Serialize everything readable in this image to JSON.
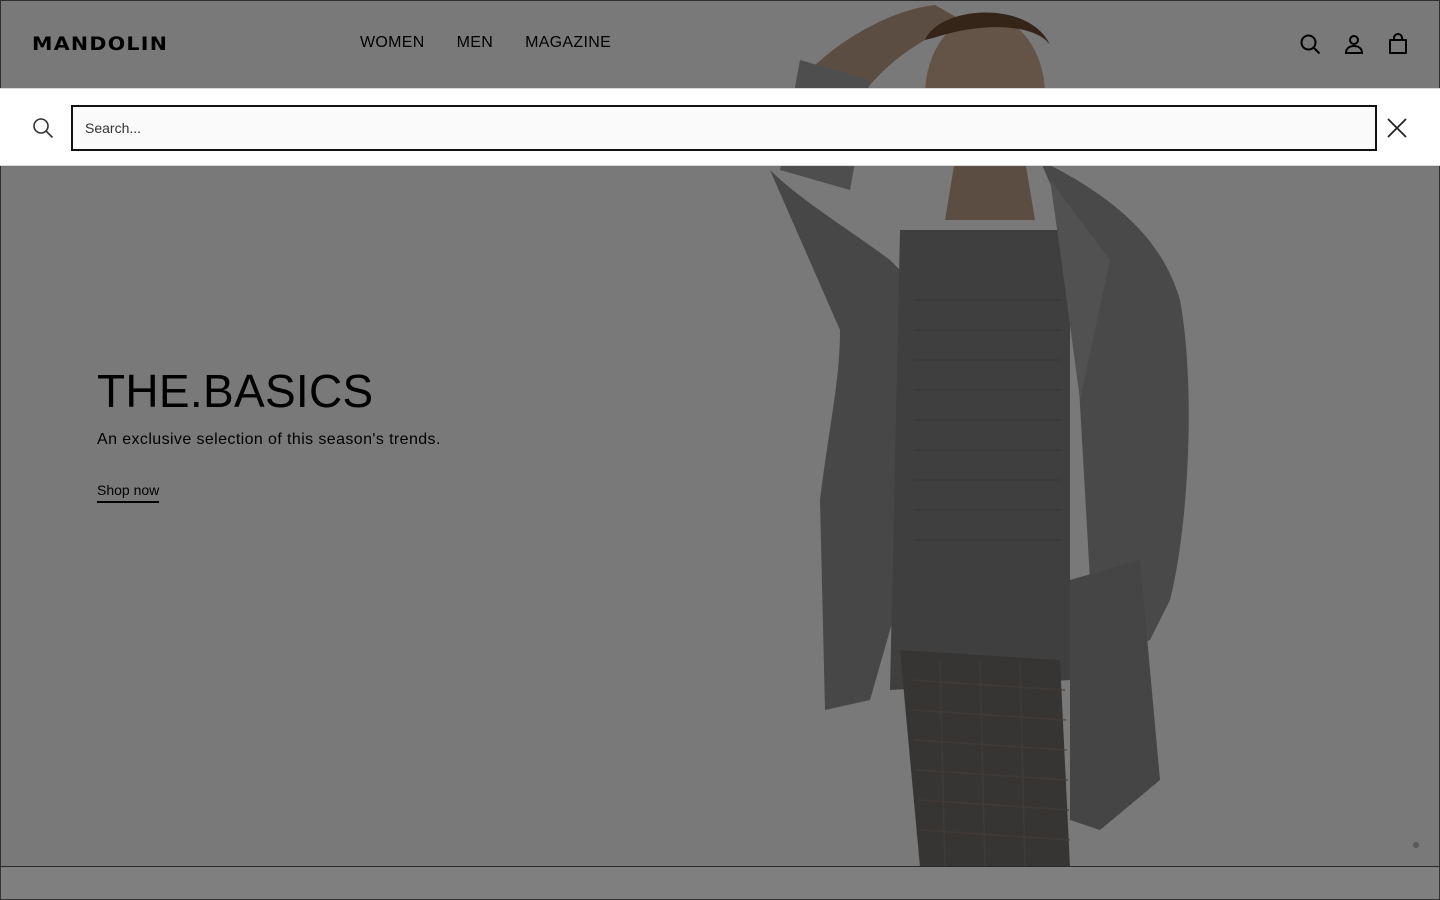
{
  "header": {
    "logo": "MANDOLIN",
    "nav": [
      {
        "label": "WOMEN"
      },
      {
        "label": "MEN"
      },
      {
        "label": "MAGAZINE"
      }
    ],
    "icons": [
      "search-icon",
      "account-icon",
      "bag-icon"
    ]
  },
  "search": {
    "placeholder": "Search...",
    "value": ""
  },
  "hero": {
    "title": "THE.BASICS",
    "subtitle": "An exclusive selection of this season's trends.",
    "cta": "Shop now"
  },
  "colors": {
    "overlay": "rgba(0,0,0,0.5)",
    "text": "#000000",
    "search_background": "#ffffff"
  }
}
